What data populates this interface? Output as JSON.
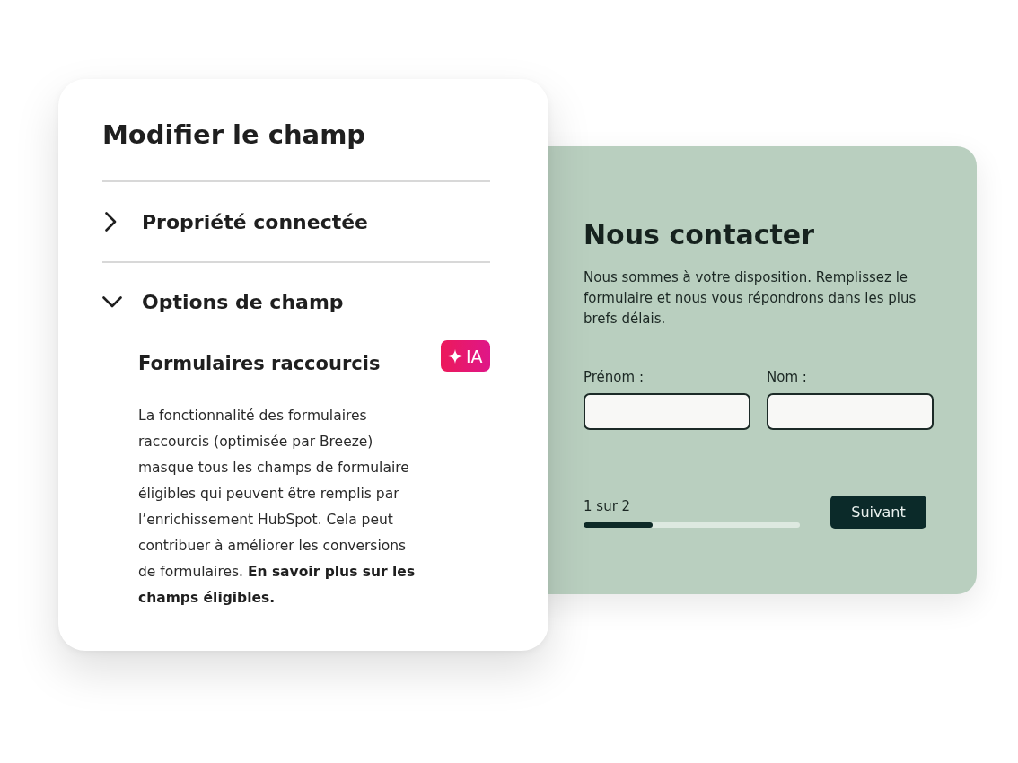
{
  "edit_panel": {
    "title": "Modifier le champ",
    "sections": [
      {
        "label": "Propriété connectée",
        "expanded": false
      },
      {
        "label": "Options de champ",
        "expanded": true,
        "content": {
          "title": "Formulaires raccourcis",
          "badge": "IA",
          "description": "La fonctionnalité des formulaires raccourcis (optimisée par Breeze) masque tous les champs de formulaire éligibles qui peuvent être remplis par l’enrichissement HubSpot. Cela peut contribuer à améliorer les conversions de formulaires. **En savoir plus sur les champs éligibles.**"
        }
      }
    ]
  },
  "contact_form": {
    "title": "Nous contacter",
    "description": "Nous sommes à votre disposition. Remplissez le formulaire et nous vous répondrons dans les plus brefs délais.",
    "fields": [
      {
        "label": "Prénom :"
      },
      {
        "label": "Nom :"
      }
    ],
    "progress": {
      "label": "1 sur 2",
      "level": 0.32
    },
    "buttons": [
      "Suivant"
    ]
  }
}
